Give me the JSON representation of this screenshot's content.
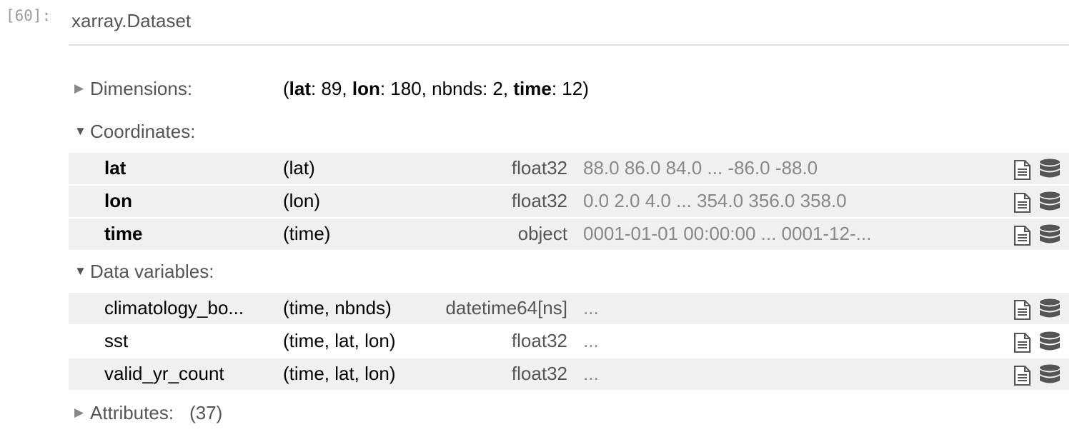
{
  "prompt": "[60]:",
  "object_type": "xarray.Dataset",
  "sections": {
    "dimensions": {
      "title": "Dimensions:",
      "arrow": "▶",
      "open_paren": "(",
      "dims": [
        {
          "name": "lat",
          "value": ": 89",
          "sep": ", ",
          "is_coord": true
        },
        {
          "name": "lon",
          "value": ": 180",
          "sep": ", ",
          "is_coord": true
        },
        {
          "name": "nbnds",
          "value": ": 2",
          "sep": ", ",
          "is_coord": false
        },
        {
          "name": "time",
          "value": ": 12",
          "sep": "",
          "is_coord": true
        }
      ],
      "close_paren": ")"
    },
    "coordinates": {
      "title": "Coordinates:",
      "arrow": "▼",
      "rows": [
        {
          "name": "lat",
          "dims": "(lat)",
          "dtype": "float32",
          "preview": "88.0 86.0 84.0 ... -86.0 -88.0"
        },
        {
          "name": "lon",
          "dims": "(lon)",
          "dtype": "float32",
          "preview": "0.0 2.0 4.0 ... 354.0 356.0 358.0"
        },
        {
          "name": "time",
          "dims": "(time)",
          "dtype": "object",
          "preview": "0001-01-01 00:00:00 ... 0001-12-..."
        }
      ]
    },
    "data_variables": {
      "title": "Data variables:",
      "arrow": "▼",
      "rows": [
        {
          "name": "climatology_bo...",
          "dims": "(time, nbnds)",
          "dtype": "datetime64[ns]",
          "preview": "..."
        },
        {
          "name": "sst",
          "dims": "(time, lat, lon)",
          "dtype": "float32",
          "preview": "..."
        },
        {
          "name": "valid_yr_count",
          "dims": "(time, lat, lon)",
          "dtype": "float32",
          "preview": "..."
        }
      ]
    },
    "attributes": {
      "title": "Attributes:",
      "arrow": "▶",
      "count": "(37)"
    }
  },
  "icons": {
    "attrs": "file-text-icon",
    "data": "database-icon"
  },
  "colors": {
    "row_shade": "#f0f0f0",
    "muted_text": "#555555",
    "preview_text": "#888888",
    "prompt_text": "#9e9e9e"
  }
}
